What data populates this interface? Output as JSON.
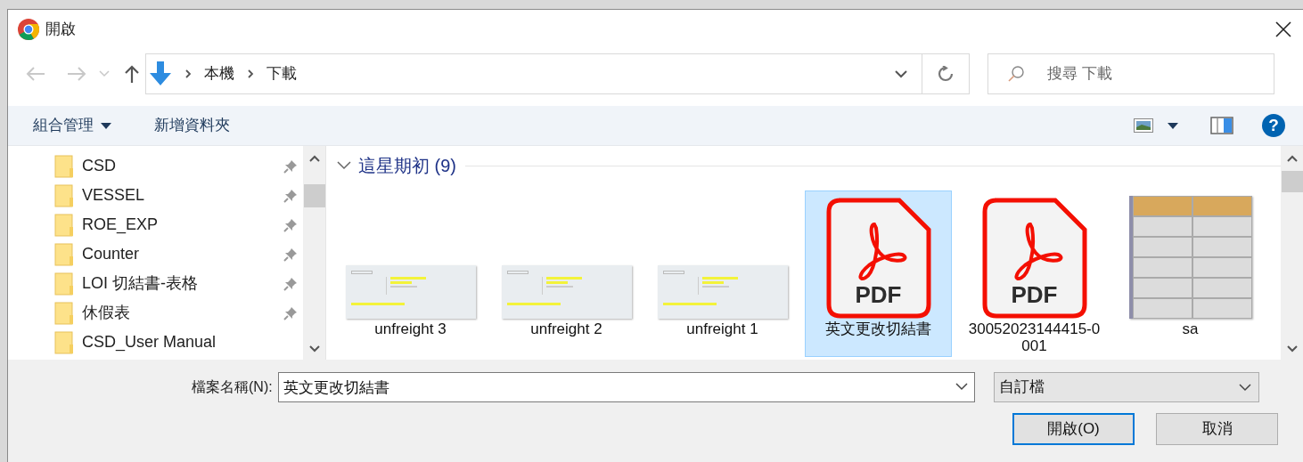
{
  "window": {
    "title": "開啟"
  },
  "address_bar": {
    "path": [
      "本機",
      "下載"
    ]
  },
  "search": {
    "placeholder": "搜尋 下載"
  },
  "toolbar": {
    "organize": "組合管理",
    "new_folder": "新增資料夾",
    "help": "?"
  },
  "sidebar": {
    "items": [
      {
        "label": "CSD",
        "pinned": true
      },
      {
        "label": "VESSEL",
        "pinned": true
      },
      {
        "label": "ROE_EXP",
        "pinned": true
      },
      {
        "label": "Counter",
        "pinned": true
      },
      {
        "label": "LOI 切結書-表格",
        "pinned": true
      },
      {
        "label": "休假表",
        "pinned": true
      },
      {
        "label": "CSD_User Manual",
        "pinned": false
      }
    ]
  },
  "group": {
    "title": "這星期初 (9)",
    "expanded": true
  },
  "files": [
    {
      "name": "unfreight 3",
      "kind": "image",
      "selected": false
    },
    {
      "name": "unfreight 2",
      "kind": "image",
      "selected": false
    },
    {
      "name": "unfreight 1",
      "kind": "image",
      "selected": false
    },
    {
      "name": "英文更改切結書",
      "kind": "pdf",
      "selected": true,
      "icon_label": "PDF"
    },
    {
      "name": "30052023144415-0001",
      "kind": "pdf",
      "selected": false,
      "icon_label": "PDF"
    },
    {
      "name": "sa",
      "kind": "sheet",
      "selected": false
    }
  ],
  "filename": {
    "label": "檔案名稱(N):",
    "value": "英文更改切結書"
  },
  "filetype": {
    "value": "自訂檔"
  },
  "buttons": [
    {
      "label": "開啟(O)",
      "kind": "primary"
    },
    {
      "label": "取消",
      "kind": "secondary"
    }
  ]
}
